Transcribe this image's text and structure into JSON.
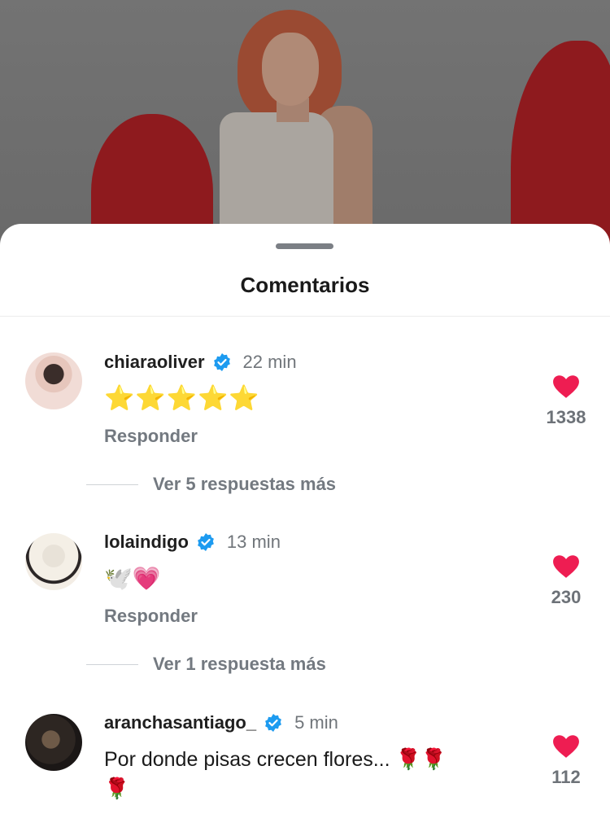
{
  "sheet": {
    "title": "Comentarios"
  },
  "comments": [
    {
      "username": "chiaraoliver",
      "time": "22 min",
      "text": "⭐⭐⭐⭐⭐",
      "reply_label": "Responder",
      "more_replies": "Ver 5 respuestas más",
      "likes": "1338",
      "verified": true
    },
    {
      "username": "lolaindigo",
      "time": "13 min",
      "text": "🕊️💗",
      "reply_label": "Responder",
      "more_replies": "Ver 1 respuesta más",
      "likes": "230",
      "verified": true
    },
    {
      "username": "aranchasantiago_",
      "time": "5 min",
      "text": "Por donde pisas crecen flores... 🌹🌹",
      "text_line2": "🌹",
      "likes": "112",
      "verified": true
    }
  ],
  "colors": {
    "verified_badge": "#1d9bf0",
    "heart": "#ee1d52",
    "secondary_text": "#737980"
  },
  "icons": {
    "verified": "verified-badge-icon",
    "like": "heart-icon"
  }
}
